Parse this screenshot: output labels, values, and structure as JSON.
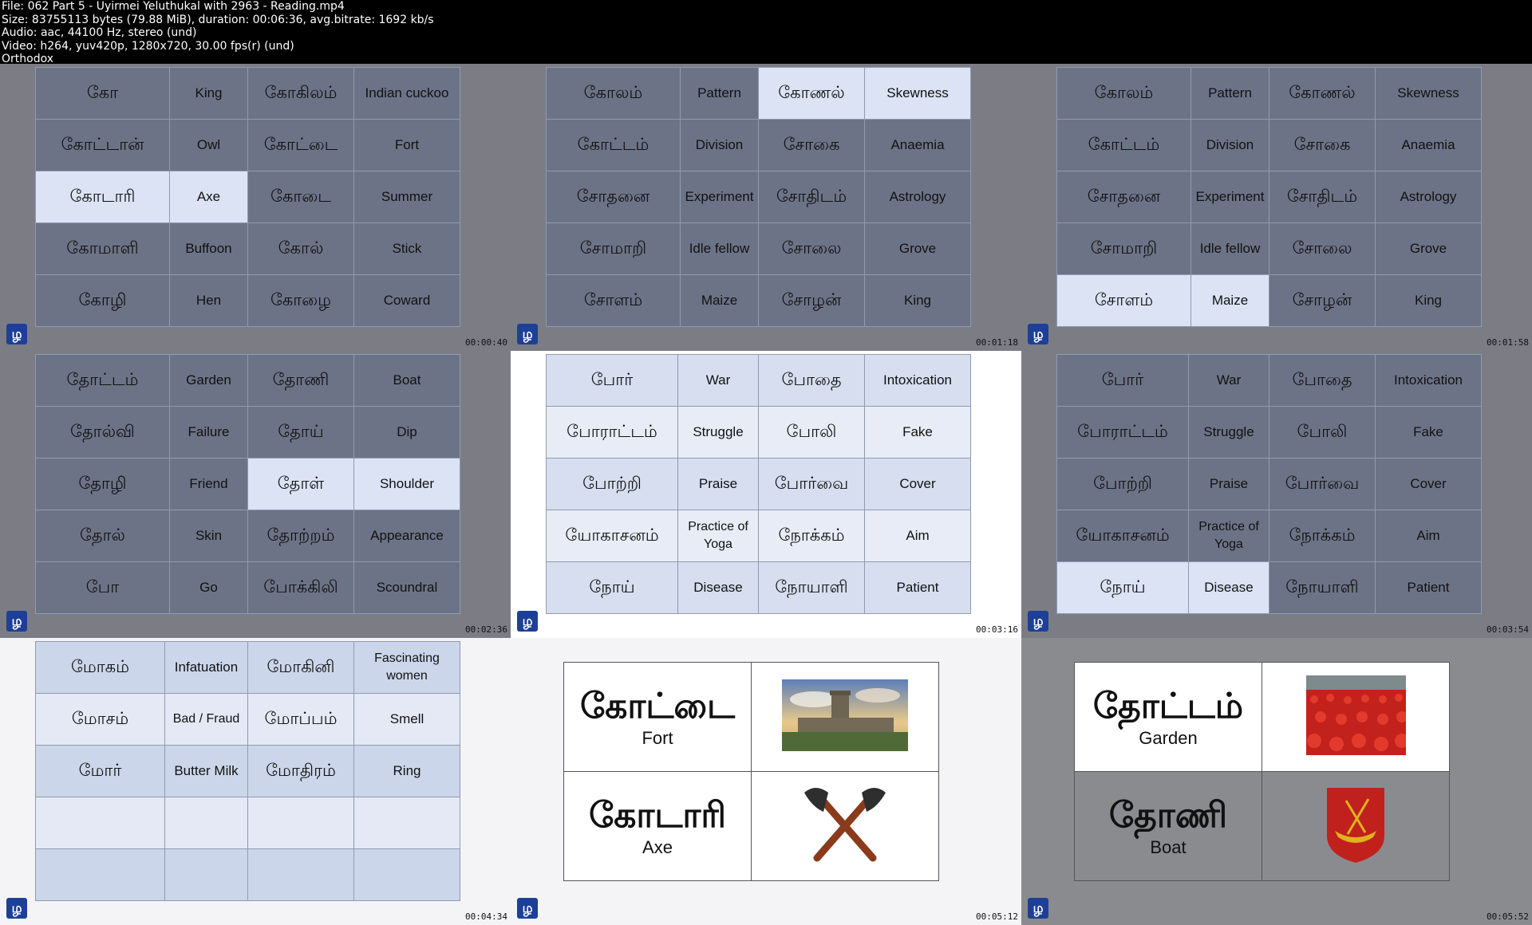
{
  "header": {
    "line1": "File: 062 Part 5 - Uyirmei Yeluthukal with 2963 - Reading.mp4",
    "line2": "Size: 83755113 bytes (79.88 MiB), duration: 00:06:36, avg.bitrate: 1692 kb/s",
    "line3": "Audio: aac, 44100 Hz, stereo (und)",
    "line4": "Video: h264, yuv420p, 1280x720, 30.00 fps(r) (und)",
    "line5": "Orthodox"
  },
  "logo_glyph": "ழ",
  "frames": [
    {
      "timestamp": "00:00:40",
      "rows": [
        [
          "கோ",
          "King",
          "கோகிலம்",
          "Indian  cuckoo"
        ],
        [
          "கோட்டான்",
          "Owl",
          "கோட்டை",
          "Fort"
        ],
        [
          "கோடாரி",
          "Axe",
          "கோடை",
          "Summer"
        ],
        [
          "கோமாளி",
          "Buffoon",
          "கோல்",
          "Stick"
        ],
        [
          "கோழி",
          "Hen",
          "கோழை",
          "Coward"
        ]
      ]
    },
    {
      "timestamp": "00:01:18",
      "rows": [
        [
          "கோலம்",
          "Pattern",
          "கோணல்",
          "Skewness"
        ],
        [
          "கோட்டம்",
          "Division",
          "சோகை",
          "Anaemia"
        ],
        [
          "சோதனை",
          "Experiment",
          "சோதிடம்",
          "Astrology"
        ],
        [
          "சோமாறி",
          "Idle  fellow",
          "சோலை",
          "Grove"
        ],
        [
          "சோளம்",
          "Maize",
          "சோழன்",
          "King"
        ]
      ]
    },
    {
      "timestamp": "00:01:58",
      "rows": [
        [
          "கோலம்",
          "Pattern",
          "கோணல்",
          "Skewness"
        ],
        [
          "கோட்டம்",
          "Division",
          "சோகை",
          "Anaemia"
        ],
        [
          "சோதனை",
          "Experiment",
          "சோதிடம்",
          "Astrology"
        ],
        [
          "சோமாறி",
          "Idle  fellow",
          "சோலை",
          "Grove"
        ],
        [
          "சோளம்",
          "Maize",
          "சோழன்",
          "King"
        ]
      ]
    },
    {
      "timestamp": "00:02:36",
      "rows": [
        [
          "தோட்டம்",
          "Garden",
          "தோணி",
          "Boat"
        ],
        [
          "தோல்வி",
          "Failure",
          "தோய்",
          "Dip"
        ],
        [
          "தோழி",
          "Friend",
          "தோள்",
          "Shoulder"
        ],
        [
          "தோல்",
          "Skin",
          "தோற்றம்",
          "Appearance"
        ],
        [
          "போ",
          "Go",
          "போக்கிலி",
          "Scoundral"
        ]
      ]
    },
    {
      "timestamp": "00:03:16",
      "rows": [
        [
          "போர்",
          "War",
          "போதை",
          "Intoxication"
        ],
        [
          "போராட்டம்",
          "Struggle",
          "போலி",
          "Fake"
        ],
        [
          "போற்றி",
          "Praise",
          "போர்வை",
          "Cover"
        ],
        [
          "யோகாசனம்",
          "Practice  of Yoga",
          "நோக்கம்",
          "Aim"
        ],
        [
          "நோய்",
          "Disease",
          "நோயாளி",
          "Patient"
        ]
      ]
    },
    {
      "timestamp": "00:03:54",
      "rows": [
        [
          "போர்",
          "War",
          "போதை",
          "Intoxication"
        ],
        [
          "போராட்டம்",
          "Struggle",
          "போலி",
          "Fake"
        ],
        [
          "போற்றி",
          "Praise",
          "போர்வை",
          "Cover"
        ],
        [
          "யோகாசனம்",
          "Practice  of Yoga",
          "நோக்கம்",
          "Aim"
        ],
        [
          "நோய்",
          "Disease",
          "நோயாளி",
          "Patient"
        ]
      ]
    },
    {
      "timestamp": "00:04:34",
      "rows": [
        [
          "மோகம்",
          "Infatuation",
          "மோகினி",
          "Fascinating women"
        ],
        [
          "மோசம்",
          "Bad  / Fraud",
          "மோப்பம்",
          "Smell"
        ],
        [
          "மோர்",
          "Butter  Milk",
          "மோதிரம்",
          "Ring"
        ],
        [
          "",
          "",
          "",
          ""
        ],
        [
          "",
          "",
          "",
          ""
        ]
      ]
    },
    {
      "timestamp": "00:05:12",
      "cards": [
        {
          "word": "கோட்டை",
          "meaning": "Fort",
          "picture": "castle"
        },
        {
          "word": "கோடாரி",
          "meaning": "Axe",
          "picture": "crossed-axes"
        }
      ]
    },
    {
      "timestamp": "00:05:52",
      "cards": [
        {
          "word": "தோட்டம்",
          "meaning": "Garden",
          "picture": "tulip-field"
        },
        {
          "word": "தோணி",
          "meaning": "Boat",
          "picture": "boat-emblem"
        }
      ]
    }
  ]
}
